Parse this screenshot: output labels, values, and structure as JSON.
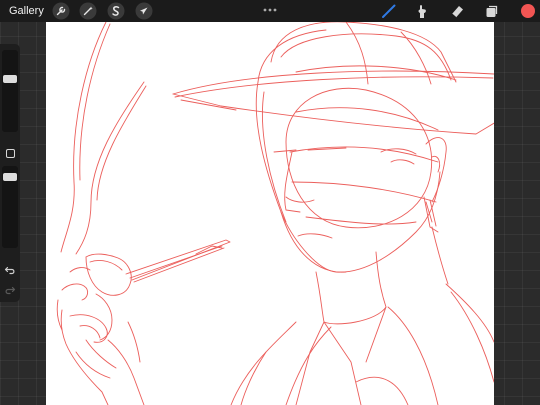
{
  "topbar": {
    "gallery_label": "Gallery",
    "tools_left": [
      {
        "icon": "wrench-icon",
        "name": "actions"
      },
      {
        "icon": "magic-wand-icon",
        "name": "adjustments"
      },
      {
        "icon": "selection-s-icon",
        "name": "selection"
      },
      {
        "icon": "arrow-cursor-icon",
        "name": "transform"
      }
    ],
    "more_icon": "three-dots-icon",
    "tools_right": [
      {
        "icon": "brush-icon",
        "name": "brush",
        "active": true
      },
      {
        "icon": "smudge-icon",
        "name": "smudge",
        "active": false
      },
      {
        "icon": "eraser-icon",
        "name": "eraser",
        "active": false
      },
      {
        "icon": "layers-icon",
        "name": "layers",
        "active": false
      }
    ],
    "current_color": "#f25553"
  },
  "sidebar": {
    "brush_size_level": 0.66,
    "opacity_level": 0.9,
    "modify_icon": "square-icon",
    "undo_icon": "undo-icon",
    "redo_icon": "redo-icon"
  },
  "canvas": {
    "background": "#ffffff",
    "sketch_color": "#e8433f"
  },
  "colors": {
    "active_tool": "#2f7ae5",
    "toolbar_bg": "#1b1b1b"
  }
}
